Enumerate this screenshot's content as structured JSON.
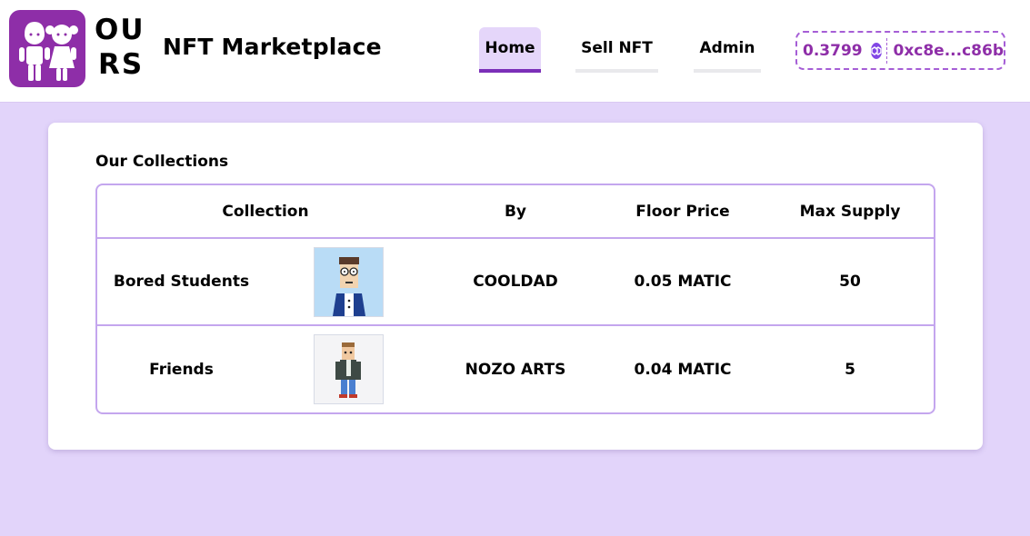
{
  "header": {
    "logo_line1": "OU",
    "logo_line2": "RS",
    "site_title": "NFT Marketplace",
    "nav": [
      {
        "label": "Home",
        "active": true
      },
      {
        "label": "Sell NFT",
        "active": false
      },
      {
        "label": "Admin",
        "active": false
      }
    ],
    "wallet": {
      "balance": "0.3799",
      "currency_icon": "polygon-matic-icon",
      "address": "0xc8e...c86b"
    }
  },
  "collections": {
    "title": "Our Collections",
    "columns": [
      "Collection",
      "By",
      "Floor Price",
      "Max Supply"
    ],
    "rows": [
      {
        "name": "Bored Students",
        "image": "bored-student-avatar",
        "by": "COOLDAD",
        "floor_price": "0.05 MATIC",
        "max_supply": "50"
      },
      {
        "name": "Friends",
        "image": "friends-character-avatar",
        "by": "NOZO ARTS",
        "floor_price": "0.04 MATIC",
        "max_supply": "5"
      }
    ]
  },
  "colors": {
    "brand_purple": "#8e2ea8",
    "page_background": "#e2d4fa",
    "table_border": "#c4a6ee",
    "nav_active_underline": "#7b2fb8"
  }
}
